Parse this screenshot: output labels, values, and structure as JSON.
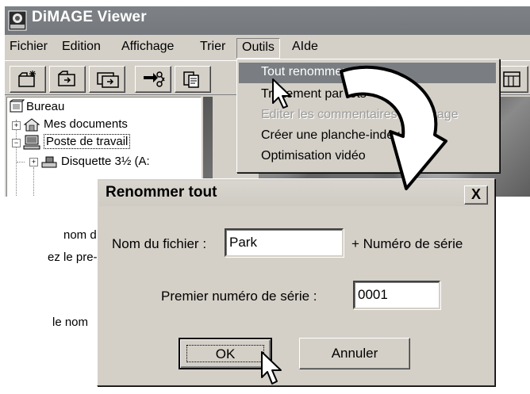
{
  "window": {
    "title": "DiMAGE Viewer"
  },
  "menubar": {
    "items": [
      "Fichier",
      "Edition",
      "Affichage",
      "Trier",
      "Outils",
      "AIde"
    ],
    "open_index": 4
  },
  "toolbar": {
    "buttons": [
      "new-folder-icon",
      "copy-icon",
      "copy-multiple-icon",
      "cut-icon",
      "paste-icon"
    ],
    "right_button": "view-icon"
  },
  "tree": {
    "items": [
      {
        "label": "Bureau",
        "icon": "desktop-icon"
      },
      {
        "label": "Mes documents",
        "icon": "documents-icon"
      },
      {
        "label": "Poste de travail",
        "icon": "computer-icon"
      },
      {
        "label": "Disquette 3½ (A:",
        "icon": "floppy-icon"
      }
    ]
  },
  "outils_menu": {
    "items": [
      {
        "label": "Tout renommer",
        "state": "highlighted"
      },
      {
        "label": "Traitement par lots",
        "state": "normal"
      },
      {
        "label": "Editer les commentaires de l'image",
        "state": "disabled"
      },
      {
        "label": "Créer une planche-index",
        "state": "normal"
      },
      {
        "label": "Optimisation vidéo",
        "state": "normal"
      }
    ]
  },
  "side_text": {
    "lines": [
      "nom de",
      "ez le pre-",
      "le nom"
    ]
  },
  "dialog": {
    "title": "Renommer tout",
    "close_label": "X",
    "filename_label": "Nom du fichier :",
    "filename_value": "Park",
    "suffix_label": "+ Numéro de série",
    "serial_label": "Premier numéro de série :",
    "serial_value": "0001",
    "ok_label": "OK",
    "cancel_label": "Annuler"
  },
  "colors": {
    "titlebar": "#7e8286",
    "window_bg": "#d4d0c8",
    "highlight": "#7a7e82"
  }
}
